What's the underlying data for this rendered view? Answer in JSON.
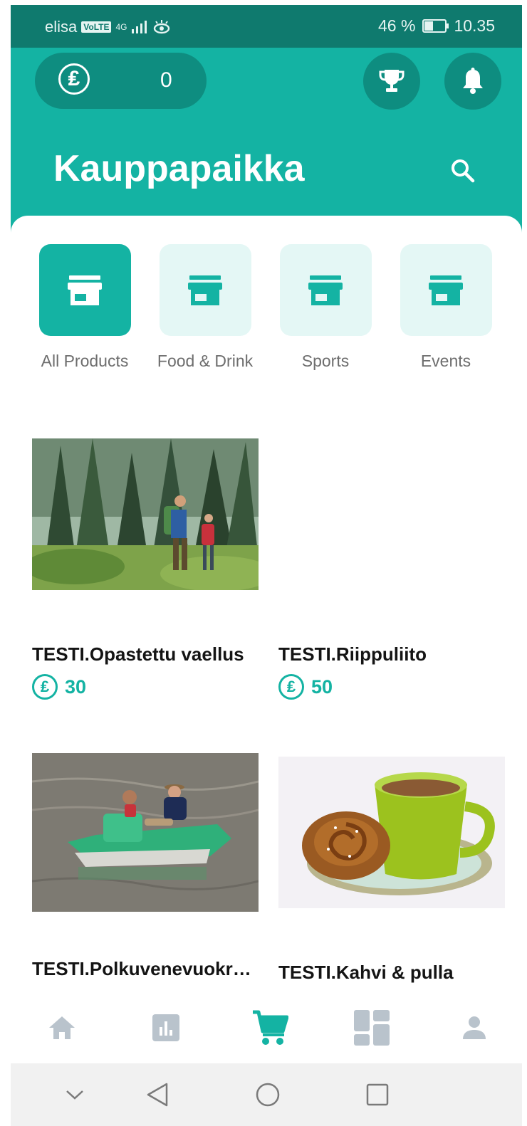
{
  "status_bar": {
    "carrier": "elisa",
    "volte": "VoLTE",
    "network": "4G",
    "battery": "46 %",
    "battery_fill_percent": 46,
    "time": "10.35"
  },
  "header": {
    "coin_balance": "0",
    "coin_symbol": "₤",
    "title": "Kauppapaikka"
  },
  "categories": [
    {
      "label": "All Products",
      "active": true
    },
    {
      "label": "Food & Drink",
      "active": false
    },
    {
      "label": "Sports",
      "active": false
    },
    {
      "label": "Events",
      "active": false
    }
  ],
  "products": [
    {
      "name": "TESTI.Opastettu vaellus",
      "price": "30",
      "has_image": true,
      "image": "hikers-forest"
    },
    {
      "name": "TESTI.Riippuliito",
      "price": "50",
      "has_image": false
    },
    {
      "name": "TESTI.Polkuvenevuokraus",
      "price": "",
      "has_image": true,
      "image": "pedal-boat"
    },
    {
      "name": "TESTI.Kahvi & pulla",
      "price": "",
      "has_image": true,
      "image": "coffee-bun"
    }
  ],
  "bottom_nav": [
    {
      "icon": "home-icon",
      "active": false
    },
    {
      "icon": "stats-icon",
      "active": false
    },
    {
      "icon": "cart-icon",
      "active": true
    },
    {
      "icon": "dashboard-icon",
      "active": false
    },
    {
      "icon": "person-icon",
      "active": false
    }
  ],
  "colors": {
    "primary": "#14b3a3",
    "primary_dark": "#0e8d80",
    "status_bar": "#0f7a6e",
    "category_bg": "#e4f7f5",
    "nav_inactive": "#b9c3cc"
  }
}
